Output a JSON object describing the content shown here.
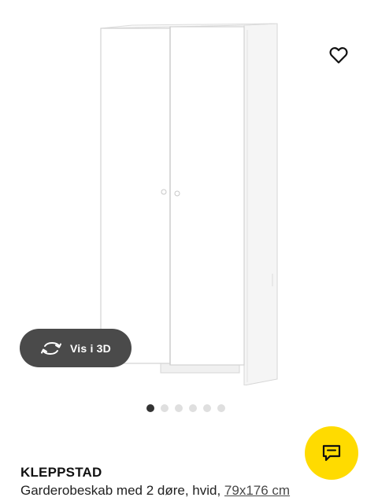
{
  "product": {
    "name": "KLEPPSTAD",
    "description": "Garderobeskab med 2 døre, hvid,",
    "size": "79x176 cm"
  },
  "view3d": {
    "label": "Vis i 3D",
    "icon": "rotate-360-icon"
  },
  "gallery": {
    "total_images": 6,
    "active_index": 0
  },
  "icons": {
    "favorite": "heart-icon",
    "chat": "chat-bubble-icon"
  },
  "colors": {
    "chat_button": "#ffdb00",
    "view3d_button": "#4a4a4a",
    "active_dot": "#333333",
    "inactive_dot": "#dfdfdf"
  }
}
